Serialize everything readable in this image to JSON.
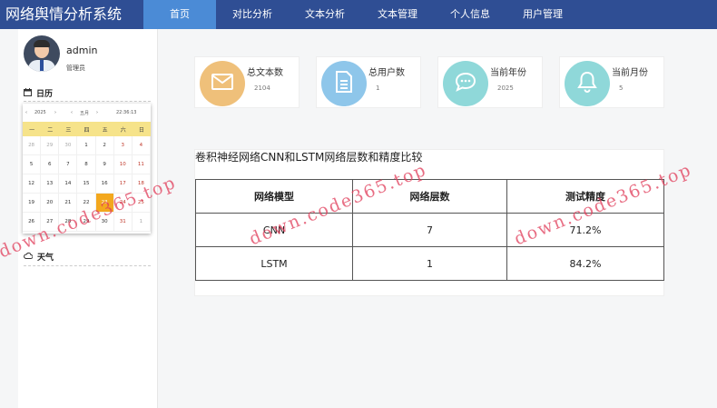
{
  "app": {
    "title": "网络舆情分析系统"
  },
  "nav": [
    {
      "label": "首页",
      "active": true
    },
    {
      "label": "对比分析"
    },
    {
      "label": "文本分析"
    },
    {
      "label": "文本管理"
    },
    {
      "label": "个人信息"
    },
    {
      "label": "用户管理"
    }
  ],
  "user": {
    "name": "admin",
    "role": "管理员"
  },
  "sidebar": {
    "calendar_title": "日历",
    "weather_title": "天气"
  },
  "calendar": {
    "year": "2025",
    "month": "五月",
    "time": "22:36:13",
    "weekdays": [
      "一",
      "二",
      "三",
      "四",
      "五",
      "六",
      "日"
    ],
    "days": [
      "28",
      "29",
      "30",
      "1",
      "2",
      "3",
      "4",
      "5",
      "6",
      "7",
      "8",
      "9",
      "10",
      "11",
      "12",
      "13",
      "14",
      "15",
      "16",
      "17",
      "18",
      "19",
      "20",
      "21",
      "22",
      "23",
      "24",
      "25",
      "26",
      "27",
      "28",
      "29",
      "30",
      "31",
      "1"
    ],
    "today": "23"
  },
  "stats": [
    {
      "label": "总文本数",
      "value": "2104",
      "color": "#efc07a",
      "icon": "mail-icon"
    },
    {
      "label": "总用户数",
      "value": "1",
      "color": "#8ec6ea",
      "icon": "document-icon"
    },
    {
      "label": "当前年份",
      "value": "2025",
      "color": "#8fd8d9",
      "icon": "chat-icon"
    },
    {
      "label": "当前月份",
      "value": "5",
      "color": "#8fd8d9",
      "icon": "bell-icon"
    }
  ],
  "compare": {
    "title": "卷积神经网络CNN和LSTM网络层数和精度比较",
    "headers": [
      "网络模型",
      "网络层数",
      "测试精度"
    ],
    "rows": [
      [
        "CNN",
        "7",
        "71.2%"
      ],
      [
        "LSTM",
        "1",
        "84.2%"
      ]
    ]
  },
  "watermark": "down.code365.top"
}
